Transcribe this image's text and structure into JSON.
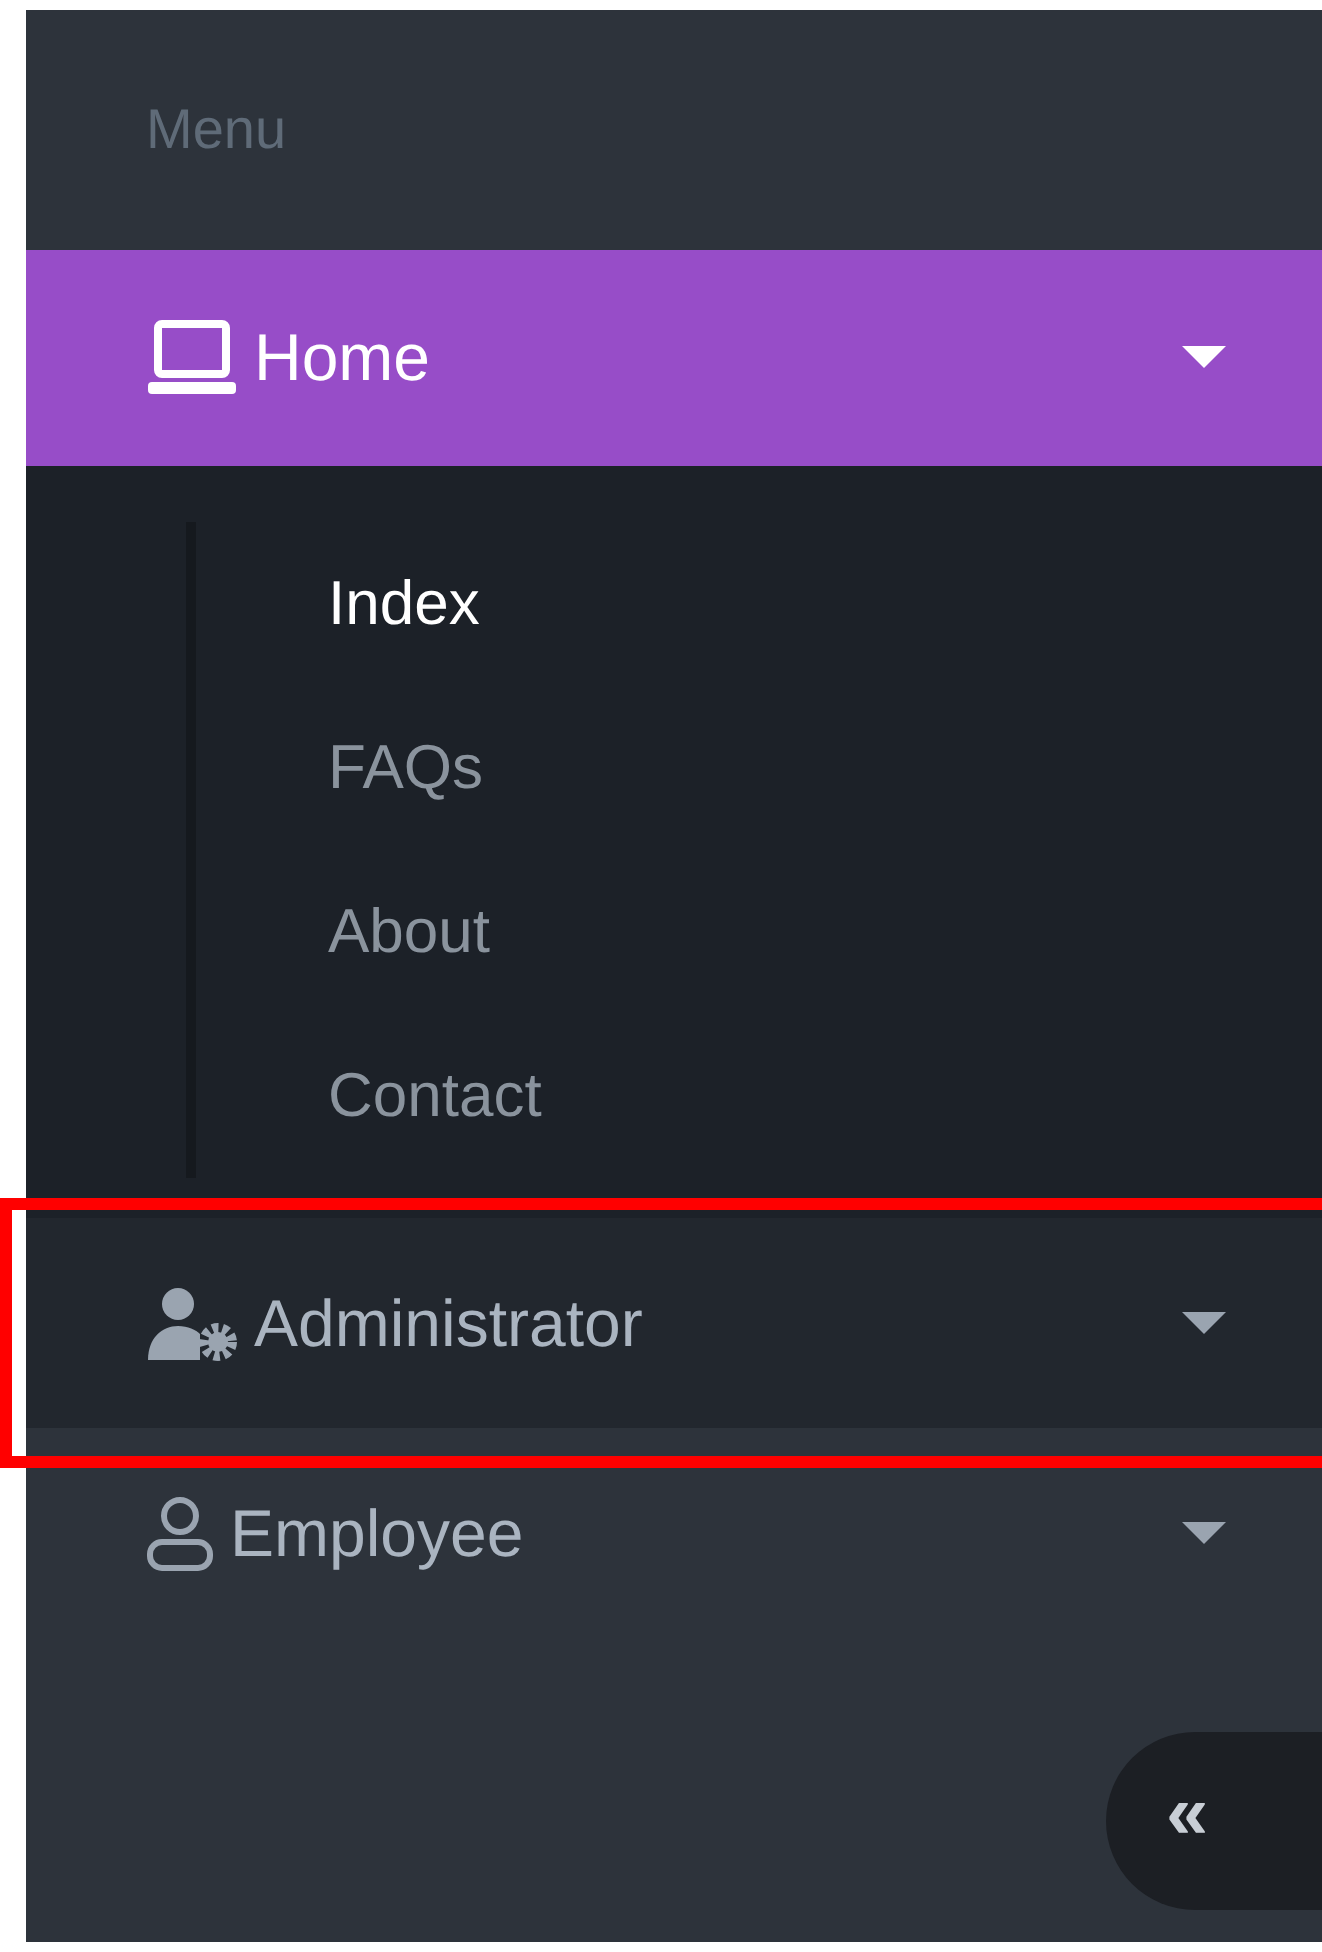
{
  "sidebar": {
    "heading": "Menu",
    "items": [
      {
        "label": "Home",
        "expanded": true,
        "hovered": false,
        "children": [
          {
            "label": "Index",
            "selected": true
          },
          {
            "label": "FAQs",
            "selected": false
          },
          {
            "label": "About",
            "selected": false
          },
          {
            "label": "Contact",
            "selected": false
          }
        ]
      },
      {
        "label": "Administrator",
        "expanded": false,
        "hovered": true,
        "highlighted": true
      },
      {
        "label": "Employee",
        "expanded": false,
        "hovered": false,
        "highlighted": false
      }
    ],
    "collapse_button": "«"
  }
}
